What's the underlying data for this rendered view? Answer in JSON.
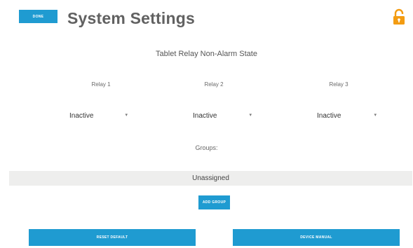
{
  "header": {
    "done_label": "DONE",
    "title": "System Settings",
    "lock_icon": "lock-open-icon",
    "lock_color": "#f39c12"
  },
  "relay_section": {
    "heading": "Tablet Relay Non-Alarm State",
    "relays": [
      {
        "label": "Relay 1",
        "value": "Inactive"
      },
      {
        "label": "Relay 2",
        "value": "Inactive"
      },
      {
        "label": "Relay 3",
        "value": "Inactive"
      }
    ]
  },
  "groups": {
    "label": "Groups:",
    "items": [
      {
        "label": "Unassigned"
      }
    ],
    "add_label": "ADD GROUP"
  },
  "footer": {
    "reset_label": "RESET DEFAULT",
    "manual_label": "DEVICE MANUAL"
  },
  "colors": {
    "accent": "#1f9bd1",
    "title": "#616161",
    "group_bar": "#eeeeed"
  }
}
